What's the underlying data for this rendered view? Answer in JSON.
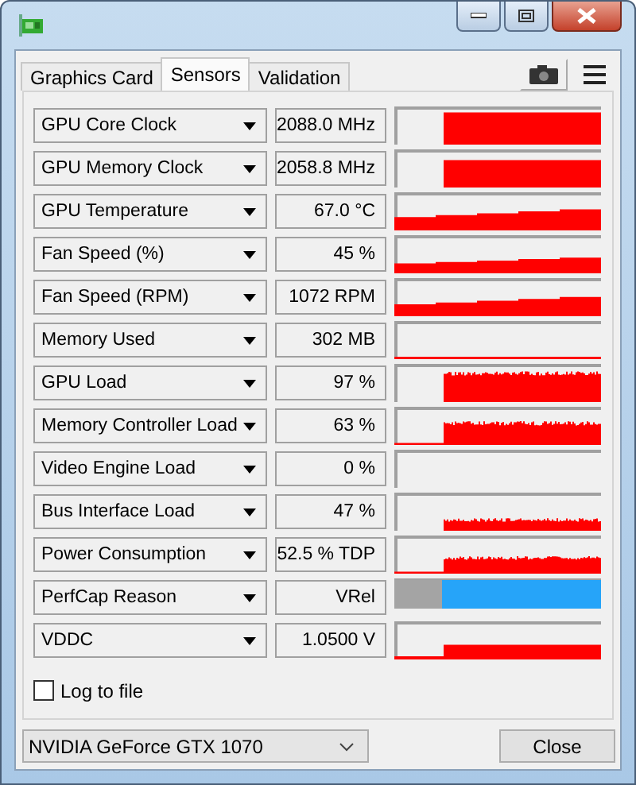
{
  "tabs": [
    {
      "label": "Graphics Card",
      "selected": false
    },
    {
      "label": "Sensors",
      "selected": true
    },
    {
      "label": "Validation",
      "selected": false
    }
  ],
  "sensors": [
    {
      "label": "GPU Core Clock",
      "value": "2088.0 MHz",
      "kind": "history"
    },
    {
      "label": "GPU Memory Clock",
      "value": "2058.8 MHz",
      "kind": "history"
    },
    {
      "label": "GPU Temperature",
      "value": "67.0 °C",
      "kind": "history"
    },
    {
      "label": "Fan Speed (%)",
      "value": "45 %",
      "kind": "history"
    },
    {
      "label": "Fan Speed (RPM)",
      "value": "1072 RPM",
      "kind": "history"
    },
    {
      "label": "Memory Used",
      "value": "302 MB",
      "kind": "history"
    },
    {
      "label": "GPU Load",
      "value": "97 %",
      "kind": "history"
    },
    {
      "label": "Memory Controller Load",
      "value": "63 %",
      "kind": "history"
    },
    {
      "label": "Video Engine Load",
      "value": "0 %",
      "kind": "history"
    },
    {
      "label": "Bus Interface Load",
      "value": "47 %",
      "kind": "history"
    },
    {
      "label": "Power Consumption",
      "value": "52.5 % TDP",
      "kind": "history"
    },
    {
      "label": "PerfCap Reason",
      "value": "VRel",
      "kind": "perfcap"
    },
    {
      "label": "VDDC",
      "value": "1.0500 V",
      "kind": "history"
    }
  ],
  "log_to_file": {
    "label": "Log to file",
    "checked": false
  },
  "gpu_select": {
    "value": "NVIDIA GeForce GTX 1070"
  },
  "close_button": "Close"
}
